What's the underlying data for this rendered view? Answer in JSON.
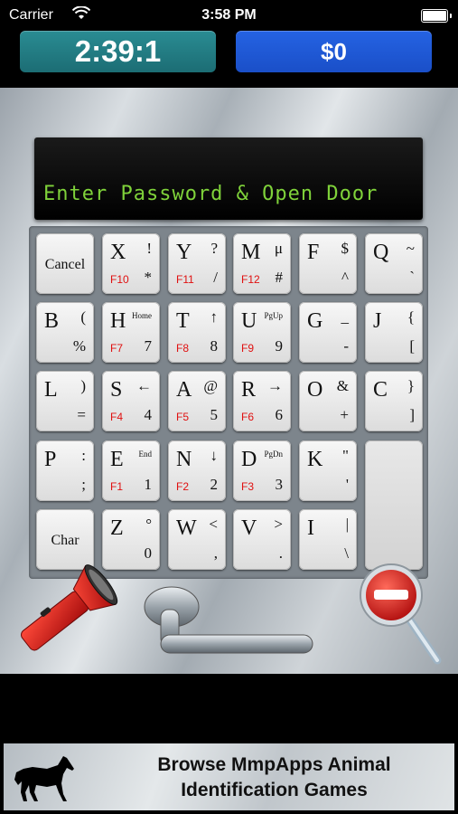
{
  "status": {
    "carrier": "Carrier",
    "time": "3:58 PM"
  },
  "header": {
    "timer": "2:39:1",
    "money": "$0"
  },
  "display": {
    "text": "Enter Password & Open Door"
  },
  "keys": [
    {
      "id": "cancel",
      "word": "Cancel"
    },
    {
      "id": "x",
      "main": "X",
      "tr": "!",
      "br": "*",
      "bl": "F10"
    },
    {
      "id": "y",
      "main": "Y",
      "tr": "?",
      "br": "/",
      "bl": "F11"
    },
    {
      "id": "m",
      "main": "M",
      "tr": "μ",
      "br": "#",
      "bl": "F12"
    },
    {
      "id": "f",
      "main": "F",
      "tr": "$",
      "br": "^"
    },
    {
      "id": "q",
      "main": "Q",
      "tr": "~",
      "br": "`"
    },
    {
      "id": "b",
      "main": "B",
      "tr": "(",
      "br": "%"
    },
    {
      "id": "h",
      "main": "H",
      "tr": "Home",
      "br": "7",
      "bl": "F7"
    },
    {
      "id": "t",
      "main": "T",
      "tr": "↑",
      "br": "8",
      "bl": "F8"
    },
    {
      "id": "u",
      "main": "U",
      "tr": "PgUp",
      "br": "9",
      "bl": "F9"
    },
    {
      "id": "g",
      "main": "G",
      "tr": "_",
      "br": "-"
    },
    {
      "id": "j",
      "main": "J",
      "tr": "{",
      "br": "["
    },
    {
      "id": "l",
      "main": "L",
      "tr": ")",
      "br": "="
    },
    {
      "id": "s",
      "main": "S",
      "tr": "←",
      "br": "4",
      "bl": "F4"
    },
    {
      "id": "a",
      "main": "A",
      "tr": "@",
      "br": "5",
      "bl": "F5"
    },
    {
      "id": "r",
      "main": "R",
      "tr": "→",
      "br": "6",
      "bl": "F6"
    },
    {
      "id": "o",
      "main": "O",
      "tr": "&",
      "br": "+"
    },
    {
      "id": "c",
      "main": "C",
      "tr": "}",
      "br": "]"
    },
    {
      "id": "p",
      "main": "P",
      "tr": ":",
      "br": ";"
    },
    {
      "id": "e",
      "main": "E",
      "tr": "End",
      "br": "1",
      "bl": "F1"
    },
    {
      "id": "n",
      "main": "N",
      "tr": "↓",
      "br": "2",
      "bl": "F2"
    },
    {
      "id": "d",
      "main": "D",
      "tr": "PgDn",
      "br": "3",
      "bl": "F3"
    },
    {
      "id": "k",
      "main": "K",
      "tr": "\"",
      "br": "'"
    },
    {
      "id": "blank"
    },
    {
      "id": "char",
      "word": "Char"
    },
    {
      "id": "z",
      "main": "Z",
      "tr": "°",
      "br": "0"
    },
    {
      "id": "w",
      "main": "W",
      "tr": "<",
      "br": ","
    },
    {
      "id": "v",
      "main": "V",
      "tr": ">",
      "br": "."
    },
    {
      "id": "i",
      "main": "I",
      "tr": "|",
      "br": "\\"
    }
  ],
  "tools": {
    "flashlight": "flashlight-icon",
    "handle": "door-handle-icon",
    "magnifier": "magnifier-icon"
  },
  "banner": {
    "line1": "Browse MmpApps Animal",
    "line2": "Identification Games",
    "icon": "horse-icon"
  },
  "colors": {
    "timer": "#1f7b82",
    "money": "#1f5ad6",
    "display_text": "#7fd23a",
    "function_label": "#e01010"
  }
}
